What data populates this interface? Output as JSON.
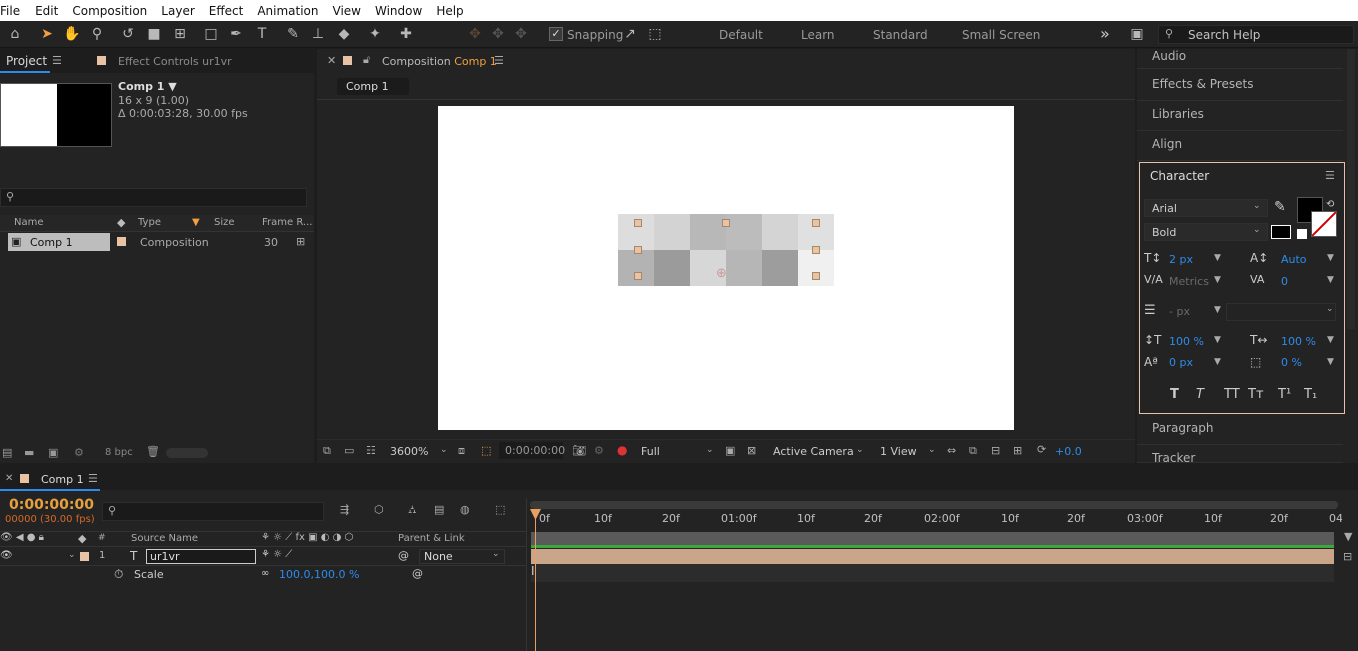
{
  "menu": [
    "File",
    "Edit",
    "Composition",
    "Layer",
    "Effect",
    "Animation",
    "View",
    "Window",
    "Help"
  ],
  "toolbar": {
    "snapping_label": "Snapping",
    "workspaces": [
      "Default",
      "Learn",
      "Standard",
      "Small Screen"
    ],
    "more": "»",
    "search_placeholder": "Search Help"
  },
  "project": {
    "tab": "Project",
    "effect_tab": "Effect Controls ur1vr",
    "comp_name": "Comp 1 ▼",
    "comp_dims": "16 x 9 (1.00)",
    "comp_duration": "Δ 0:00:03:28, 30.00 fps",
    "columns": [
      "Name",
      "Type",
      "Size",
      "Frame R..."
    ],
    "rows": [
      {
        "name": "Comp 1",
        "type": "Composition",
        "fps": "30"
      }
    ],
    "bpc": "8 bpc"
  },
  "composition": {
    "tab_prefix": "Composition",
    "tab_name": "Comp 1",
    "breadcrumb": "Comp 1",
    "zoom": "3600%",
    "time": "0:00:00:00",
    "resolution": "Full",
    "camera": "Active Camera",
    "view": "1 View",
    "exposure": "+0.0"
  },
  "right_panels": {
    "audio": "Audio",
    "effects": "Effects & Presets",
    "libraries": "Libraries",
    "align": "Align",
    "character": "Character",
    "paragraph": "Paragraph",
    "tracker": "Tracker"
  },
  "character": {
    "font": "Arial",
    "style": "Bold",
    "size": "2 px",
    "leading": "Auto",
    "kerning": "Metrics",
    "tracking": "0",
    "stroke": "- px",
    "vscale": "100 %",
    "hscale": "100 %",
    "baseline": "0 px",
    "tsume": "0 %",
    "styles": [
      "T",
      "T",
      "TT",
      "Tт",
      "T¹",
      "T₁"
    ]
  },
  "timeline": {
    "tab": "Comp 1",
    "timecode": "0:00:00:00",
    "fps": "00000 (30.00 fps)",
    "columns": {
      "source": "Source Name",
      "parent": "Parent & Link"
    },
    "layer": {
      "index": "1",
      "name": "ur1vr",
      "parent": "None"
    },
    "property": {
      "name": "Scale",
      "value": "100.0,100.0 %"
    },
    "ruler": [
      "0f",
      "10f",
      "20f",
      "01:00f",
      "10f",
      "20f",
      "02:00f",
      "10f",
      "20f",
      "03:00f",
      "10f",
      "20f",
      "04"
    ]
  }
}
